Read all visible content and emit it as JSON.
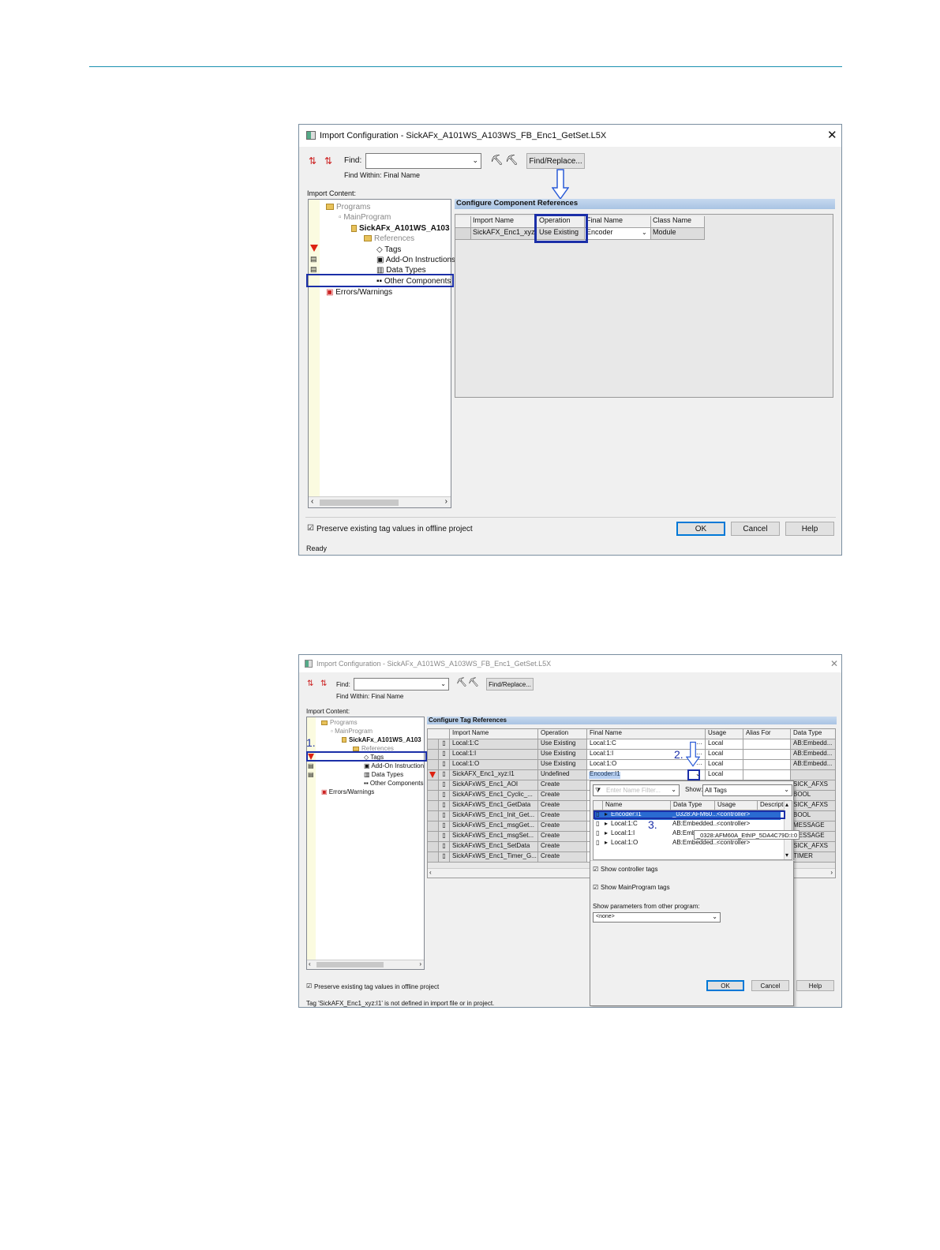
{
  "w1": {
    "title": "Import Configuration - SickAFx_A101WS_A103WS_FB_Enc1_GetSet.L5X",
    "find_label": "Find:",
    "find_within": "Find Within: Final Name",
    "find_replace": "Find/Replace...",
    "import_content": "Import Content:",
    "tree": [
      "Programs",
      "MainProgram",
      "SickAFx_A101WS_A103",
      "References",
      "Tags",
      "Add-On Instructions",
      "Data Types",
      "Other Components",
      "Errors/Warnings"
    ],
    "panel_title": "Configure Component References",
    "cols": [
      "Import Name",
      "Operation",
      "Final Name",
      "Class Name"
    ],
    "row": [
      "SickAFX_Enc1_xyz",
      "Use Existing",
      "Encoder",
      "Module"
    ],
    "preserve": "Preserve existing tag values in offline project",
    "ok": "OK",
    "cancel": "Cancel",
    "help": "Help",
    "status": "Ready"
  },
  "w2": {
    "title": "Import Configuration - SickAFx_A101WS_A103WS_FB_Enc1_GetSet.L5X",
    "find_label": "Find:",
    "find_within": "Find Within: Final Name",
    "find_replace": "Find/Replace...",
    "import_content": "Import Content:",
    "tree": [
      "Programs",
      "MainProgram",
      "SickAFx_A101WS_A103",
      "References",
      "Tags",
      "Add-On Instruction",
      "Data Types",
      "Other Components",
      "Errors/Warnings"
    ],
    "panel_title": "Configure Tag References",
    "cols": [
      "Import Name",
      "Operation",
      "Final Name",
      "Usage",
      "Alias For",
      "Data Type"
    ],
    "rows": [
      [
        "Local:1:C",
        "Use Existing",
        "Local:1:C",
        "Local",
        "",
        "AB:Embedd..."
      ],
      [
        "Local:1:I",
        "Use Existing",
        "Local:1:I",
        "Local",
        "",
        "AB:Embedd..."
      ],
      [
        "Local:1:O",
        "Use Existing",
        "Local:1:O",
        "Local",
        "",
        "AB:Embedd..."
      ],
      [
        "SickAFX_Enc1_xyz:I1",
        "Undefined",
        "Encoder:I1",
        "Local",
        "",
        ""
      ],
      [
        "SickAFxWS_Enc1_AOI",
        "Create",
        "",
        "",
        "",
        "SICK_AFXS"
      ],
      [
        "SickAFxWS_Enc1_Cyclic_...",
        "Create",
        "",
        "",
        "",
        "BOOL"
      ],
      [
        "SickAFxWS_Enc1_GetData",
        "Create",
        "",
        "",
        "",
        "SICK_AFXS"
      ],
      [
        "SickAFxWS_Enc1_Init_Get...",
        "Create",
        "",
        "",
        "",
        "BOOL"
      ],
      [
        "SickAFxWS_Enc1_msgGet...",
        "Create",
        "",
        "",
        "",
        "MESSAGE"
      ],
      [
        "SickAFxWS_Enc1_msgSet...",
        "Create",
        "",
        "",
        "",
        "MESSAGE"
      ],
      [
        "SickAFxWS_Enc1_SetData",
        "Create",
        "",
        "",
        "",
        "SICK_AFXS"
      ],
      [
        "SickAFxWS_Enc1_Timer_G...",
        "Create",
        "",
        "",
        "",
        "TIMER"
      ]
    ],
    "popup": {
      "filter_placeholder": "Enter Name Filter...",
      "show_label": "Show:",
      "show_value": "All Tags",
      "cols": [
        "Name",
        "Data Type",
        "Usage",
        "Descripti"
      ],
      "rows": [
        [
          "Encoder:I1",
          "_0328:AFM60...",
          "<controller>"
        ],
        [
          "Local:1:C",
          "AB:Embedded...",
          "<controller>"
        ],
        [
          "Local:1:I",
          "AB:Embe",
          "<controller>"
        ],
        [
          "Local:1:O",
          "AB:Embedded...",
          "<controller>"
        ]
      ],
      "tooltip": "_0328:AFM60A_EthIP_5DA4C79D:I:0",
      "show_controller": "Show controller tags",
      "show_program": "Show MainProgram tags",
      "show_params": "Show parameters from other program:",
      "params_value": "<none>"
    },
    "preserve": "Preserve existing tag values in offline project",
    "ok": "OK",
    "cancel": "Cancel",
    "help": "Help",
    "status": "Tag 'SickAFX_Enc1_xyz:I1' is not defined in import file or in project.",
    "steps": [
      "1.",
      "2.",
      "3."
    ]
  }
}
